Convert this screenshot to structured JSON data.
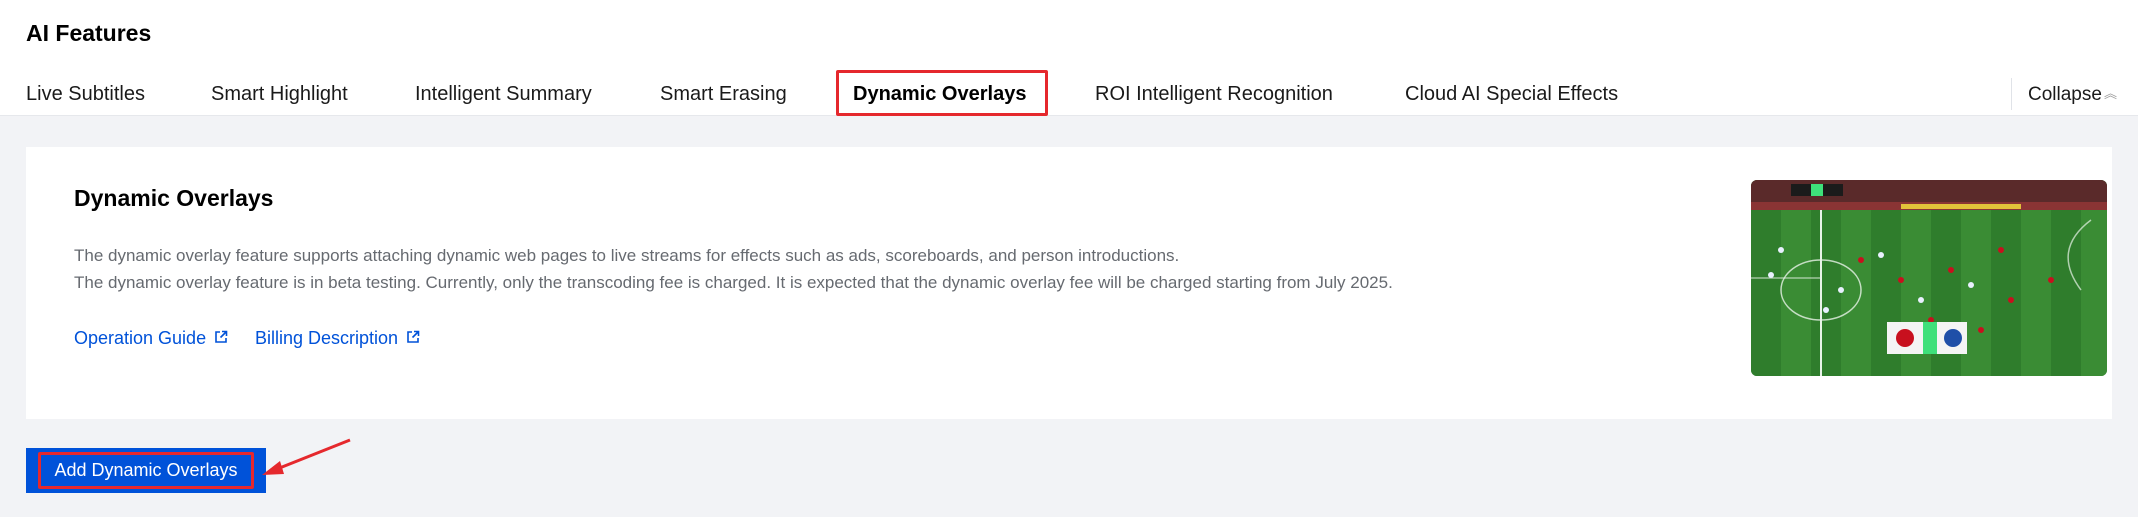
{
  "header": {
    "title": "AI Features",
    "tabs": [
      {
        "label": "Live Subtitles"
      },
      {
        "label": "Smart Highlight"
      },
      {
        "label": "Intelligent Summary"
      },
      {
        "label": "Smart Erasing"
      },
      {
        "label": "Dynamic Overlays",
        "active": true
      },
      {
        "label": "ROI Intelligent Recognition"
      },
      {
        "label": "Cloud AI Special Effects"
      }
    ],
    "collapse_label": "Collapse",
    "collapse_icon": "chevron-up-icon"
  },
  "card": {
    "title": "Dynamic Overlays",
    "description_1": "The dynamic overlay feature supports attaching dynamic web pages to live streams for effects such as ads, scoreboards, and person introductions.",
    "description_2": "The dynamic overlay feature is in beta testing. Currently, only the transcoding fee is charged. It is expected that the dynamic overlay fee will be charged starting from July 2025.",
    "links": [
      {
        "label": "Operation Guide",
        "icon": "external-link-icon"
      },
      {
        "label": "Billing Description",
        "icon": "external-link-icon"
      }
    ],
    "thumbnail": "football-match-overlay-preview"
  },
  "actions": {
    "add_label": "Add Dynamic Overlays"
  },
  "colors": {
    "accent": "#0052d9",
    "highlight": "#e5282d",
    "page_bg": "#f2f3f6",
    "description": "#666a70"
  }
}
